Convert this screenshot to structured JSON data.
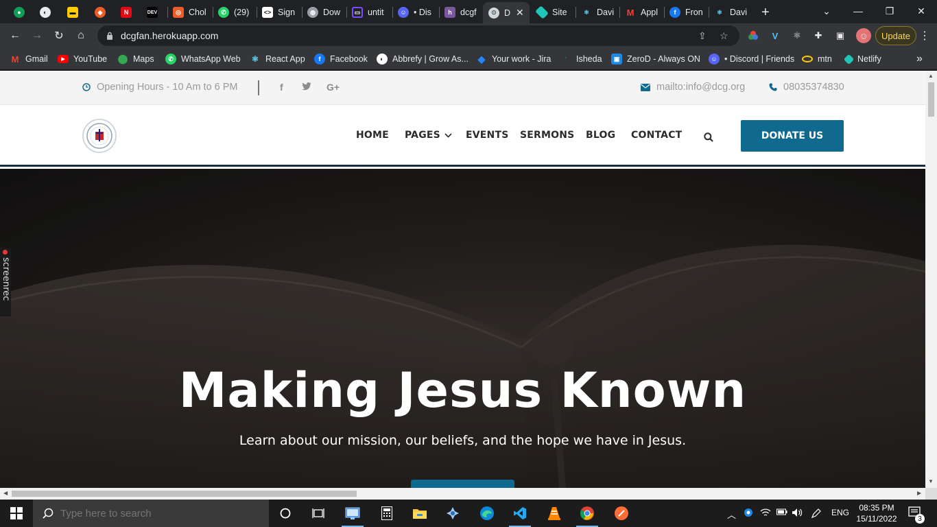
{
  "browser": {
    "tabs": [
      {
        "label": "",
        "icon": "leaf-icon",
        "color": "#0f9d58"
      },
      {
        "label": "",
        "icon": "github-icon",
        "color": "#24292e"
      },
      {
        "label": "",
        "icon": "mtn-icon",
        "color": "#ffcc00"
      },
      {
        "label": "",
        "icon": "postman-icon",
        "color": "#ef5b25"
      },
      {
        "label": "",
        "icon": "netflix-n-icon",
        "color": "#e50914"
      },
      {
        "label": "",
        "icon": "dev-icon",
        "color": "#000000"
      },
      {
        "label": "Chol",
        "icon": "chol-icon",
        "color": "#ef5b25"
      },
      {
        "label": "(29) ",
        "icon": "whatsapp-icon",
        "color": "#25d366"
      },
      {
        "label": "Sign",
        "icon": "code-icon",
        "color": "#ffffff"
      },
      {
        "label": "Dow",
        "icon": "globe-icon",
        "color": "#9aa0a6"
      },
      {
        "label": "untit",
        "icon": "monitor-icon",
        "color": "#7c4dff"
      },
      {
        "label": "• Dis",
        "icon": "discord-icon",
        "color": "#5865f2"
      },
      {
        "label": "dcgf",
        "icon": "heroku-icon",
        "color": "#79589f"
      },
      {
        "label": "D",
        "icon": "site-icon",
        "color": "#cfd8dc",
        "active": true
      },
      {
        "label": "Site",
        "icon": "netlify-icon",
        "color": "#20c6b7"
      },
      {
        "label": "Davi",
        "icon": "react-icon",
        "color": "#61dafb"
      },
      {
        "label": "Appl",
        "icon": "gmail-icon",
        "color": "#ea4335"
      },
      {
        "label": "Fron",
        "icon": "facebook-icon",
        "color": "#1877f2"
      },
      {
        "label": "Davi",
        "icon": "react-icon",
        "color": "#61dafb"
      }
    ],
    "new_tab": "+",
    "url": "dcgfan.herokuapp.com",
    "update_label": "Update",
    "bookmarks": [
      {
        "label": "Gmail",
        "icon": "gmail-icon",
        "color": "#ea4335"
      },
      {
        "label": "YouTube",
        "icon": "youtube-icon",
        "color": "#ff0000"
      },
      {
        "label": "Maps",
        "icon": "maps-icon",
        "color": "#34a853"
      },
      {
        "label": "WhatsApp Web",
        "icon": "whatsapp-icon",
        "color": "#25d366"
      },
      {
        "label": "React App",
        "icon": "react-icon",
        "color": "#61dafb"
      },
      {
        "label": "Facebook",
        "icon": "facebook-icon",
        "color": "#1877f2"
      },
      {
        "label": "Abbrefy | Grow As...",
        "icon": "abbrefy-icon",
        "color": "#ffffff"
      },
      {
        "label": "Your work - Jira",
        "icon": "jira-icon",
        "color": "#2684ff"
      },
      {
        "label": "Isheda",
        "icon": "isheda-icon",
        "color": "#0f9d58"
      },
      {
        "label": "ZeroD - Always ON",
        "icon": "zerod-icon",
        "color": "#1e88e5"
      },
      {
        "label": "• Discord | Friends",
        "icon": "discord-icon",
        "color": "#5865f2"
      },
      {
        "label": "mtn",
        "icon": "mtn-icon",
        "color": "#ffcc00"
      },
      {
        "label": "Netlify",
        "icon": "netlify-icon",
        "color": "#20c6b7"
      }
    ],
    "bookmarks_more": "»"
  },
  "site": {
    "topbar": {
      "hours": "Opening Hours - 10 Am to 6 PM",
      "email": "mailto:info@dcg.org",
      "phone": "08035374830",
      "social": {
        "facebook": "f",
        "twitter": "t",
        "google": "G+"
      }
    },
    "nav": {
      "home": "HOME",
      "pages": "PAGES",
      "events": "EVENTS",
      "sermons": "SERMONS",
      "blog": "BLOG",
      "contact": "CONTACT",
      "donate": "DONATE US"
    },
    "hero": {
      "title": "Making Jesus Known",
      "subtitle": "Learn about our mission, our beliefs, and the hope we have in Jesus."
    },
    "colors": {
      "accent": "#10698e",
      "nav_border": "#182d3e"
    }
  },
  "screenrec": {
    "label": "screenrec"
  },
  "taskbar": {
    "search_placeholder": "Type here to search",
    "language": "ENG",
    "time": "08:35 PM",
    "date": "15/11/2022",
    "notification_count": "3"
  }
}
